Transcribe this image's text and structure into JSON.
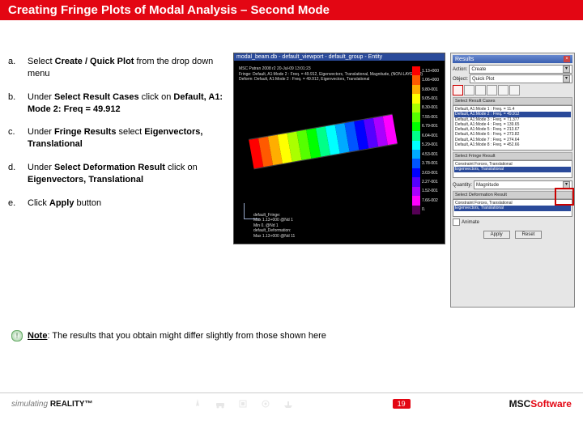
{
  "title": "Creating Fringe Plots of Modal Analysis – Second Mode",
  "steps": {
    "a": {
      "label": "a.",
      "pre": "Select ",
      "bold": "Create / Quick Plot",
      "post": " from the drop down menu"
    },
    "b": {
      "label": "b.",
      "pre": "Under ",
      "bold": "Select Result Cases",
      "post": " click on ",
      "bold2": "Default, A1: Mode 2: Freq = 49.912"
    },
    "c": {
      "label": "c.",
      "pre": "Under ",
      "bold": "Fringe Results",
      "post": " select ",
      "bold2": "Eigenvectors, Translational"
    },
    "d": {
      "label": "d.",
      "pre": "Under ",
      "bold": "Select Deformation Result",
      "post": " click on ",
      "bold2": "Eigenvectors, Translational"
    },
    "e": {
      "label": "e.",
      "pre": "Click ",
      "bold": "Apply",
      "post": " button"
    }
  },
  "note": {
    "bold": "Note",
    "text": ": The results that you obtain might differ slightly from those shown here"
  },
  "fringe": {
    "window_title": "modal_beam.db - default_viewport - default_group - Entity",
    "overlay_top": "MSC Patran 2008 r2 20-Jul-09 13:01:23\nFringe: Default, A1:Mode 2 : Freq. = 49.912, Eigenvectors, Translational, Magnitude, (NON-LAYERED)\nDeform: Default, A1:Mode 2 : Freq. = 49.912, Eigenvectors, Translational",
    "overlay_bottom": "default_Fringe:\nMax 1.13+000 @Nd 1\nMin 0. @Nd 1\ndefault_Deformation:\nMax 1.13+000 @Nd 11",
    "scale": [
      {
        "val": "1.13+000",
        "c": "#ff0000"
      },
      {
        "val": "1.06+000",
        "c": "#ff5a00"
      },
      {
        "val": "9.80-001",
        "c": "#ffae00"
      },
      {
        "val": "9.05-001",
        "c": "#ffff00"
      },
      {
        "val": "8.30-001",
        "c": "#aaff00"
      },
      {
        "val": "7.55-001",
        "c": "#55ff00"
      },
      {
        "val": "6.79-001",
        "c": "#00ff00"
      },
      {
        "val": "6.04-001",
        "c": "#00ff88"
      },
      {
        "val": "5.29-001",
        "c": "#00ffff"
      },
      {
        "val": "4.53-001",
        "c": "#00aaff"
      },
      {
        "val": "3.78-001",
        "c": "#0055ff"
      },
      {
        "val": "3.03-001",
        "c": "#0000ff"
      },
      {
        "val": "2.27-001",
        "c": "#5500ff"
      },
      {
        "val": "1.52-001",
        "c": "#aa00ff"
      },
      {
        "val": "7.66-002",
        "c": "#ff00ff"
      },
      {
        "val": "0.",
        "c": "#550055"
      }
    ],
    "beam_colors": [
      "#ff0000",
      "#ff5a00",
      "#ffae00",
      "#ffff00",
      "#aaff00",
      "#55ff00",
      "#00ff00",
      "#00ff88",
      "#00ffff",
      "#00aaff",
      "#0055ff",
      "#0000ff",
      "#5500ff",
      "#aa00ff",
      "#ff00ff"
    ]
  },
  "results": {
    "header": "Results",
    "action_label": "Action:",
    "action_value": "Create",
    "object_label": "Object:",
    "object_value": "Quick Plot",
    "cases_label": "Select Result Cases",
    "cases": [
      {
        "t": "Default, A1:Mode 1 : Freq. = 11.4",
        "sel": false
      },
      {
        "t": "Default, A1:Mode 2 : Freq. = 49.912",
        "sel": true
      },
      {
        "t": "Default, A1:Mode 3 : Freq. = 71.377",
        "sel": false
      },
      {
        "t": "Default, A1:Mode 4 : Freq. = 139.65",
        "sel": false
      },
      {
        "t": "Default, A1:Mode 5 : Freq. = 213.67",
        "sel": false
      },
      {
        "t": "Default, A1:Mode 6 : Freq. = 273.82",
        "sel": false
      },
      {
        "t": "Default, A1:Mode 7 : Freq. = 274.64",
        "sel": false
      },
      {
        "t": "Default, A1:Mode 8 : Freq. = 452.66",
        "sel": false
      }
    ],
    "fringe_label": "Select Fringe Result",
    "fringe_items": [
      {
        "t": "Constraint Forces, Translational",
        "sel": false
      },
      {
        "t": "Eigenvectors, Translational",
        "sel": true
      }
    ],
    "quantity_label": "Quantity:",
    "quantity_value": "Magnitude",
    "deform_label": "Select Deformation Result",
    "deform_items": [
      {
        "t": "Constraint Forces, Translational",
        "sel": false
      },
      {
        "t": "Eigenvectors, Translational",
        "sel": true
      }
    ],
    "animate_label": "Animate",
    "apply": "Apply",
    "reset": "Reset"
  },
  "footer": {
    "simulating": "simulating",
    "reality": "REALITY™",
    "page": "19",
    "brand1": "MSC",
    "brand2": "Software"
  }
}
